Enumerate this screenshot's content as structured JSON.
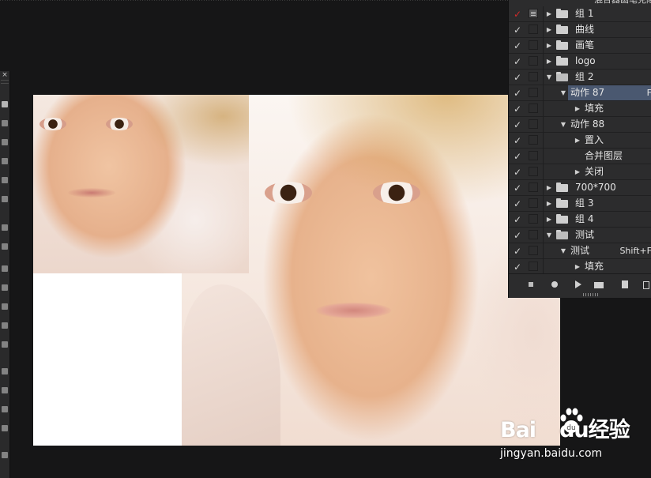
{
  "toolbox": {
    "close_label": "×"
  },
  "actions_panel": {
    "title_fragment": "混合器画笔克隆",
    "rows": [
      {
        "name": "组 1",
        "check": "✓",
        "red": true,
        "dialog": true,
        "level": 0,
        "type": "set",
        "expanded": false,
        "key": ""
      },
      {
        "name": "曲线",
        "check": "✓",
        "red": false,
        "dialog": false,
        "level": 0,
        "type": "set",
        "expanded": false,
        "key": ""
      },
      {
        "name": "画笔",
        "check": "✓",
        "red": false,
        "dialog": false,
        "level": 0,
        "type": "set",
        "expanded": false,
        "key": ""
      },
      {
        "name": "logo",
        "check": "✓",
        "red": false,
        "dialog": false,
        "level": 0,
        "type": "set",
        "expanded": false,
        "key": ""
      },
      {
        "name": "组 2",
        "check": "✓",
        "red": false,
        "dialog": false,
        "level": 0,
        "type": "set",
        "expanded": true,
        "key": ""
      },
      {
        "name": "动作 87",
        "check": "✓",
        "red": false,
        "dialog": false,
        "level": 1,
        "type": "action",
        "expanded": true,
        "key": "F",
        "selected": true
      },
      {
        "name": "填充",
        "check": "✓",
        "red": false,
        "dialog": false,
        "level": 2,
        "type": "step",
        "expanded": false,
        "key": ""
      },
      {
        "name": "动作 88",
        "check": "✓",
        "red": false,
        "dialog": false,
        "level": 1,
        "type": "action",
        "expanded": true,
        "key": ""
      },
      {
        "name": "置入",
        "check": "✓",
        "red": false,
        "dialog": false,
        "level": 2,
        "type": "step",
        "expanded": false,
        "key": ""
      },
      {
        "name": "合并图层",
        "check": "✓",
        "red": false,
        "dialog": false,
        "level": 2,
        "type": "step-leaf",
        "expanded": false,
        "key": ""
      },
      {
        "name": "关闭",
        "check": "✓",
        "red": false,
        "dialog": false,
        "level": 2,
        "type": "step",
        "expanded": false,
        "key": ""
      },
      {
        "name": "700*700",
        "check": "✓",
        "red": false,
        "dialog": false,
        "level": 0,
        "type": "set",
        "expanded": false,
        "key": ""
      },
      {
        "name": "组 3",
        "check": "✓",
        "red": false,
        "dialog": false,
        "level": 0,
        "type": "set",
        "expanded": false,
        "key": ""
      },
      {
        "name": "组 4",
        "check": "✓",
        "red": false,
        "dialog": false,
        "level": 0,
        "type": "set",
        "expanded": false,
        "key": ""
      },
      {
        "name": "测试",
        "check": "✓",
        "red": false,
        "dialog": false,
        "level": 0,
        "type": "set",
        "expanded": true,
        "key": ""
      },
      {
        "name": "测试",
        "check": "✓",
        "red": false,
        "dialog": false,
        "level": 1,
        "type": "action",
        "expanded": true,
        "key": "Shift+F"
      },
      {
        "name": "填充",
        "check": "✓",
        "red": false,
        "dialog": false,
        "level": 2,
        "type": "step",
        "expanded": false,
        "key": ""
      }
    ],
    "footer_buttons": [
      "stop",
      "record",
      "play",
      "new-set",
      "new-action",
      "delete"
    ]
  },
  "watermark": {
    "brand_text": "Bai",
    "brand_text2": "du",
    "brand_suffix": "经验",
    "url": "jingyan.baidu.com"
  }
}
